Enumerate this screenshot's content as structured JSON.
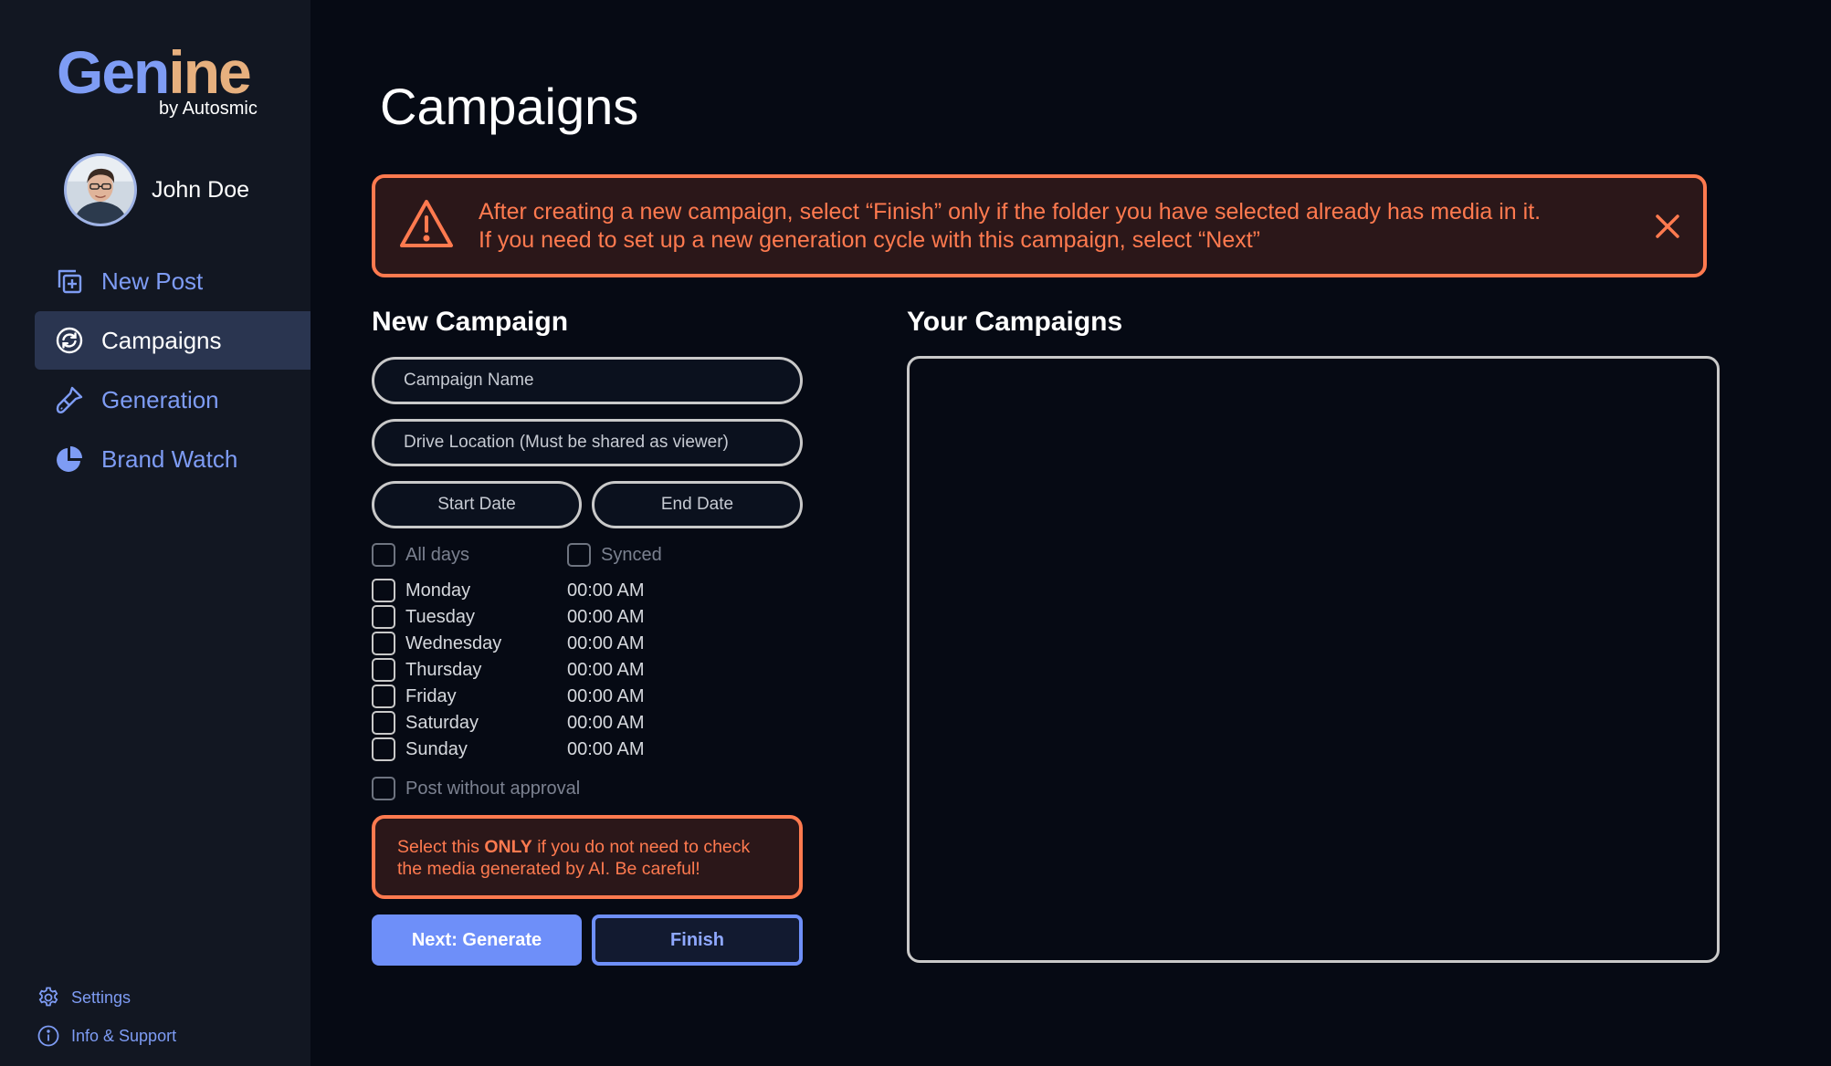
{
  "brand": {
    "logo_part1": "Gen",
    "logo_part2": "ine",
    "byline": "by Autosmic"
  },
  "user": {
    "name": "John Doe"
  },
  "nav": {
    "items": [
      {
        "label": "New Post",
        "icon": "new-post-icon"
      },
      {
        "label": "Campaigns",
        "icon": "campaigns-icon",
        "active": true
      },
      {
        "label": "Generation",
        "icon": "brush-icon"
      },
      {
        "label": "Brand Watch",
        "icon": "pie-chart-icon"
      }
    ]
  },
  "footer_links": {
    "settings": "Settings",
    "support": "Info & Support"
  },
  "page": {
    "title": "Campaigns"
  },
  "alert": {
    "line1": "After creating a new campaign, select “Finish” only if the folder you have selected already has media in it.",
    "line2": "If you need to set up a new generation cycle with this campaign, select “Next”"
  },
  "new_campaign": {
    "title": "New Campaign",
    "campaign_name_placeholder": "Campaign Name",
    "drive_location_placeholder": "Drive Location (Must be shared as viewer)",
    "start_date": "Start Date",
    "end_date": "End Date",
    "all_days_label": "All days",
    "synced_label": "Synced",
    "days": [
      {
        "day": "Monday",
        "time": "00:00 AM"
      },
      {
        "day": "Tuesday",
        "time": "00:00 AM"
      },
      {
        "day": "Wednesday",
        "time": "00:00 AM"
      },
      {
        "day": "Thursday",
        "time": "00:00 AM"
      },
      {
        "day": "Friday",
        "time": "00:00 AM"
      },
      {
        "day": "Saturday",
        "time": "00:00 AM"
      },
      {
        "day": "Sunday",
        "time": "00:00 AM"
      }
    ],
    "post_without_approval_label": "Post without approval",
    "warning_prefix": "Select this ",
    "warning_bold": "ONLY",
    "warning_suffix_line1": " if you do not need to check",
    "warning_line2": "the media generated by AI. Be careful!",
    "next_button": "Next: Generate",
    "finish_button": "Finish"
  },
  "your_campaigns": {
    "title": "Your Campaigns"
  },
  "colors": {
    "background": "#060a14",
    "sidebar": "#121722",
    "accent_blue": "#7e9cf4",
    "accent_orange": "#ff7a4f",
    "logo_orange": "#e7b07e"
  }
}
